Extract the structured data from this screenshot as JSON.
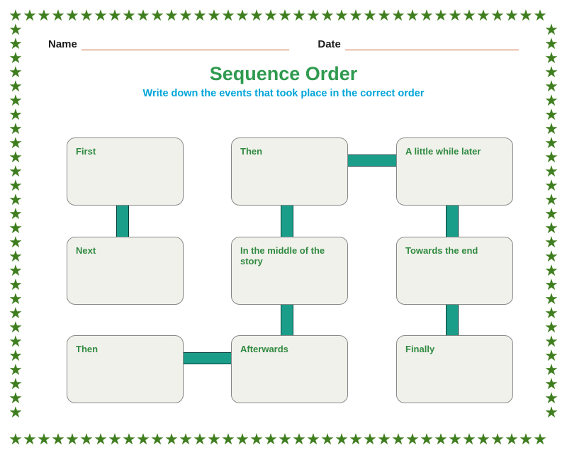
{
  "header": {
    "name_label": "Name",
    "date_label": "Date"
  },
  "title": "Sequence Order",
  "subtitle": "Write down the events that took place in the correct order",
  "boxes": {
    "b1": "First",
    "b2": "Then",
    "b3": "A little while later",
    "b4": "Next",
    "b5": "In the middle of the story",
    "b6": "Towards the end",
    "b7": "Then",
    "b8": "Afterwards",
    "b9": "Finally"
  }
}
